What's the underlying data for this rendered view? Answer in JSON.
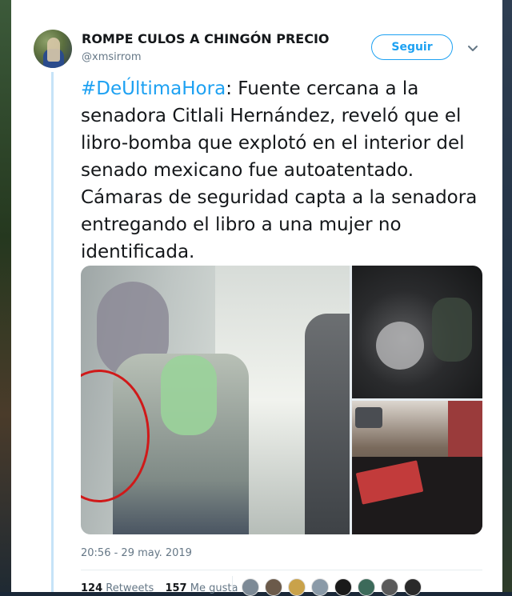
{
  "tweet": {
    "display_name": "ROMPE CULOS A CHINGÓN PRECIO",
    "handle": "@xmsirrom",
    "follow_label": "Seguir",
    "hashtag": "#DeÚltimaHora",
    "text": ": Fuente cercana a la senadora Citlali Hernández, reveló que el libro-bomba que explotó en el interior del senado mexicano fue autoatentado. Cámaras de seguridad capta a la senadora entregando el libro a una mujer no identificada.",
    "timestamp": "20:56 - 29 may. 2019",
    "retweets_count": "124",
    "retweets_label": "Retweets",
    "likes_count": "157",
    "likes_label": "Me gusta"
  },
  "colors": {
    "accent": "#1da1f2",
    "text": "#14171a",
    "muted": "#657786",
    "thread_line": "#c6e3f8",
    "highlight_circle": "#d01919"
  },
  "icons": {
    "caret": "chevron-down-icon"
  },
  "liker_avatars": [
    "#7d8a96",
    "#6b5a4a",
    "#c9a24a",
    "#8a9aa8",
    "#1a1a1a",
    "#3c6a5a",
    "#5a5a5a",
    "#2a2a2a"
  ]
}
